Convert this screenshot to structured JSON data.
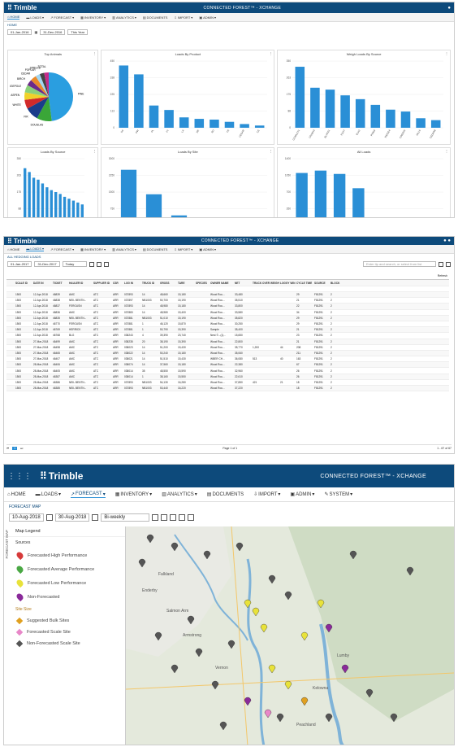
{
  "app": {
    "logo": "Trimble",
    "title_p1": "CONNECTED FOREST™ - XCHANGE",
    "title_p2": "CONNECTED FOREST™ - XCHANGE",
    "title_p3": "CONNECTED FOREST™ - XCHANGE"
  },
  "nav": [
    "HOME",
    "LOADS",
    "FORECAST",
    "INVENTORY",
    "ANALYTICS",
    "DOCUMENTS",
    "IMPORT",
    "ADMIN"
  ],
  "nav3": [
    "HOME",
    "LOADS",
    "FORECAST",
    "INVENTORY",
    "ANALYTICS",
    "DOCUMENTS",
    "IMPORT",
    "ADMIN",
    "SYSTEM"
  ],
  "p1": {
    "crumb": "HOME",
    "date_from": "01-Jan-2016",
    "date_to": "31-Dec-2016",
    "period": "This Year"
  },
  "p2": {
    "crumb": "ALL HEDGING LOADS",
    "date_from": "01-Jan-2017",
    "date_to": "31-Dec-2017",
    "period": "Today",
    "search_placeholder": "Enter tip and search, or select from list",
    "page_text": "Page 1 of 1",
    "status": "1 - 67 of 67",
    "refresh": "Refresh"
  },
  "p3": {
    "crumb": "FORECAST MAP",
    "date_from": "10-Aug-2018",
    "date_to": "30-Aug-2018",
    "period": "Bi-weekly",
    "legend_title": "Map Legend",
    "sources_label": "Sources",
    "site_label": "Site Size",
    "side_tab": "FORECAST MAP",
    "sources": [
      {
        "label": "Forecasted High Performance",
        "color": "#d63a3a"
      },
      {
        "label": "Forecasted Average Performance",
        "color": "#4aa844"
      },
      {
        "label": "Forecasted Low Performance",
        "color": "#e8e23a"
      },
      {
        "label": "Non-Forecasted",
        "color": "#8a2a9a"
      }
    ],
    "sites": [
      {
        "label": "Suggested Bulk Sites",
        "color": "#e0a020"
      },
      {
        "label": "Forecasted Scale Site",
        "color": "#e887c8"
      },
      {
        "label": "Non-Forecasted Scale Site",
        "color": "#555555"
      }
    ],
    "map_labels": [
      "Enderby",
      "Salmon Arm",
      "Armstrong",
      "Vernon",
      "Kelowna",
      "Peachland",
      "Lumby",
      "Falkland"
    ]
  },
  "charts": [
    {
      "title": "Top Animals",
      "type": "pie",
      "labels": [
        "PINE",
        "DOUGLAS",
        "FIR",
        "WHITE",
        "ASPEN",
        "LODGEPOLE",
        "BIRCH",
        "CEDAR",
        "POPLAR",
        "SPRUCE",
        "TOTAL"
      ],
      "values": [
        48,
        10,
        9,
        6,
        5,
        5,
        4,
        4,
        3,
        3,
        3
      ],
      "colors": [
        "#2a9ee0",
        "#3aa638",
        "#1a3d8a",
        "#d12a2a",
        "#f0d22a",
        "#8bd17a",
        "#6c2a8a",
        "#e98a2a",
        "#a2d6f0",
        "#444444",
        "#c62a8a"
      ]
    },
    {
      "title": "Loads By Product",
      "type": "bar",
      "categories": [
        "SA",
        "PW",
        "PL",
        "FT",
        "LA",
        "DE",
        "BU",
        "TR",
        "CEDAR",
        "CE"
      ],
      "values": [
        420,
        360,
        150,
        120,
        70,
        60,
        55,
        40,
        25,
        15
      ],
      "ylim": [
        0,
        450
      ]
    },
    {
      "title": "Weigh Loads By Source",
      "type": "bar",
      "categories": [
        "COWLEY1",
        "CRAB10",
        "BLAKE1",
        "FOX7",
        "ELK2",
        "PINE3",
        "RIDGE4",
        "CREEK5",
        "HILL6",
        "CEDAR8"
      ],
      "values": [
        320,
        210,
        200,
        170,
        150,
        120,
        95,
        85,
        50,
        40
      ],
      "ylim": [
        0,
        350
      ]
    },
    {
      "title": "Loads By Source",
      "type": "bar",
      "categories": [
        "S1",
        "S2",
        "S3",
        "S4",
        "S5",
        "S6",
        "S7",
        "S8",
        "S9",
        "S10",
        "S11",
        "S12",
        "S13",
        "S14"
      ],
      "values": [
        300,
        280,
        250,
        240,
        220,
        200,
        185,
        175,
        165,
        150,
        140,
        130,
        120,
        110
      ],
      "ylim": [
        0,
        350
      ]
    },
    {
      "title": "Loads By Site",
      "type": "bar",
      "categories": [
        "YSH",
        "535",
        "546",
        "RBI",
        "ABO1",
        "GRH"
      ],
      "values": [
        2500,
        1400,
        450,
        60,
        20,
        15
      ],
      "ylim": [
        0,
        3000
      ]
    },
    {
      "title": "All Loads",
      "type": "bar",
      "categories": [
        "Jan-16",
        "Feb-16",
        "Mar-16",
        "Apr-16",
        "May-16",
        "Jun-16",
        "Jul-16",
        "Aug-16"
      ],
      "values": [
        1100,
        1150,
        1080,
        780,
        60,
        70,
        80,
        60
      ],
      "ylim": [
        0,
        1400
      ]
    }
  ],
  "table": {
    "headers": [
      "",
      "SCALE ID",
      "DATE IN",
      "TICKET",
      "HAULER ID",
      "SUPPLIER ID",
      "CSR",
      "LOG IN",
      "TRUCK ID",
      "GROSS",
      "TARE",
      "SPECIES",
      "OWNER NAME",
      "NET",
      "TRUCK OVER WEIGHT",
      "LOGGY WIN",
      "CYCLE TIME",
      "SOURCE",
      "BLOCK"
    ],
    "rows": [
      [
        "",
        "1500",
        "12-Apr-2018",
        "46839",
        "AMC",
        "ATC",
        "ARR",
        "037893",
        "14",
        "48,660",
        "15,180",
        "",
        "Wood Rou...",
        "33,480",
        "",
        "",
        "29",
        "F81291",
        "2"
      ],
      [
        "",
        "1500",
        "12-Apr-2018",
        "46838",
        "NEIL BENTN...",
        "ATC",
        "ARR",
        "037897",
        "NB1003",
        "50,700",
        "15,190",
        "",
        "Wood Rou...",
        "35,510",
        "",
        "",
        "21",
        "F81291",
        "2"
      ],
      [
        "",
        "1500",
        "12-Apr-2018",
        "46837",
        "FERGUSN",
        "ATC",
        "ARR",
        "037893",
        "14",
        "48,980",
        "15,180",
        "",
        "Wood Rou...",
        "33,800",
        "",
        "",
        "22",
        "F81291",
        "2"
      ],
      [
        "",
        "1500",
        "12-Apr-2018",
        "46836",
        "AMC",
        "ATC",
        "ARR",
        "037883",
        "14",
        "48,980",
        "15,400",
        "",
        "Wood Rou...",
        "33,580",
        "",
        "",
        "34",
        "F81291",
        "2"
      ],
      [
        "",
        "1500",
        "12-Apr-2018",
        "46835",
        "NEIL BENTN...",
        "ATC",
        "ARR",
        "037881",
        "NB1003",
        "51,010",
        "15,190",
        "",
        "Wood Rou...",
        "35,820",
        "",
        "",
        "29",
        "F81291",
        "2"
      ],
      [
        "",
        "1500",
        "12-Apr-2018",
        "46770",
        "FERGUSN",
        "ATC",
        "ARR",
        "037881",
        "1",
        "46,120",
        "15,870",
        "",
        "Wood Rou...",
        "30,250",
        "",
        "",
        "29",
        "F81291",
        "2"
      ],
      [
        "",
        "1500",
        "12-Apr-2018",
        "46769",
        "HERRICK",
        "ATC",
        "ARR",
        "037881",
        "1",
        "50,790",
        "15,390",
        "",
        "Sample",
        "35,400",
        "",
        "",
        "21",
        "F81291",
        "2"
      ],
      [
        "",
        "1500",
        "12-Apr-2018",
        "46768",
        "BLG",
        "ATC",
        "ARR",
        "038243",
        "4",
        "39,390",
        "23,740",
        "",
        "Nest ©...(1)...",
        "15,650",
        "",
        "",
        "23",
        "F81291",
        "2"
      ],
      [
        "",
        "1500",
        "27-Mar-2018",
        "46499",
        "AMC",
        "ATC",
        "ARR",
        "038235",
        "20",
        "38,190",
        "15,390",
        "",
        "Wood Rou...",
        "22,800",
        "",
        "",
        "21",
        "F81291",
        "2"
      ],
      [
        "",
        "1500",
        "27-Mar-2018",
        "46498",
        "AMC",
        "ATC",
        "ARR",
        "038023",
        "14",
        "51,200",
        "15,430",
        "",
        "Wood Rou...",
        "35,770",
        "1,200",
        "44",
        "208",
        "F81291",
        "2"
      ],
      [
        "",
        "1500",
        "27-Mar-2018",
        "46465",
        "AMC",
        "ATC",
        "ARR",
        "038022",
        "14",
        "50,240",
        "15,180",
        "",
        "Wood Rou...",
        "35,060",
        "",
        "",
        "211",
        "F81291",
        "2"
      ],
      [
        "",
        "1500",
        "27-Mar-2018",
        "46407",
        "AMC",
        "ATC",
        "ARR",
        "038021",
        "14",
        "51,510",
        "15,430",
        "",
        "WBER CH...",
        "36,080",
        "513",
        "40",
        "163",
        "F81291",
        "2"
      ],
      [
        "",
        "1500",
        "28-Mar-2018",
        "46406",
        "AMC",
        "ATC",
        "ARR",
        "038074",
        "14",
        "37,560",
        "15,180",
        "",
        "Wood Rou...",
        "22,380",
        "",
        "",
        "67",
        "F81291",
        "2"
      ],
      [
        "",
        "1500",
        "28-Mar-2018",
        "46405",
        "AMC",
        "ATC",
        "ARR",
        "038014",
        "35",
        "48,550",
        "15,590",
        "",
        "Wood Rou...",
        "32,960",
        "",
        "",
        "26",
        "F81291",
        "2"
      ],
      [
        "",
        "1500",
        "28-Mar-2018",
        "46387",
        "AMC",
        "ATC",
        "ARR",
        "038014",
        "1",
        "38,160",
        "15,550",
        "",
        "Wood Rou...",
        "22,610",
        "",
        "",
        "26",
        "F81291",
        "2"
      ],
      [
        "",
        "1500",
        "28-Mar-2018",
        "46386",
        "NEIL BENTN...",
        "ATC",
        "ARR",
        "037893",
        "NB1003",
        "54,130",
        "16,280",
        "",
        "Wood Rou...",
        "37,850",
        "421",
        "21",
        "18",
        "F81291",
        "2"
      ],
      [
        "",
        "1500",
        "28-Mar-2018",
        "46385",
        "NEIL BENTN...",
        "ATC",
        "ARR",
        "037893",
        "NB1003",
        "53,440",
        "16,220",
        "",
        "Wood Rou...",
        "37,220",
        "",
        "",
        "18",
        "F81291",
        "2"
      ]
    ]
  }
}
